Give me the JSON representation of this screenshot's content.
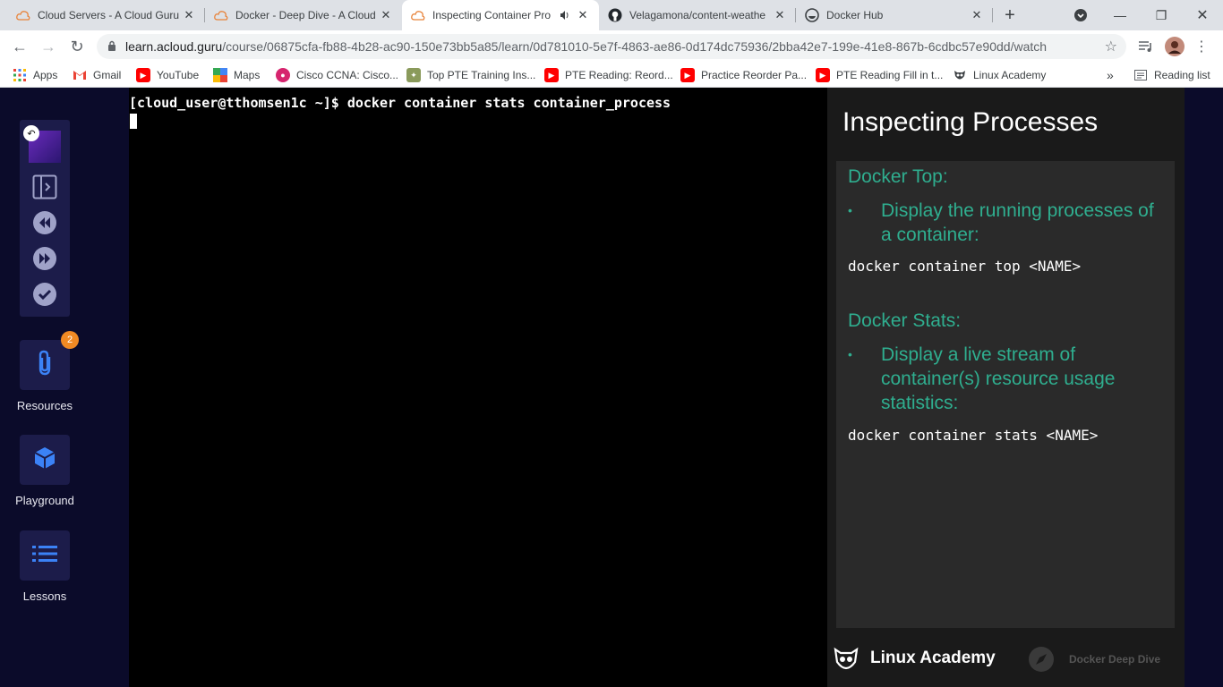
{
  "tabs": [
    {
      "title": "Cloud Servers - A Cloud Guru",
      "favicon": "cloud-icon"
    },
    {
      "title": "Docker - Deep Dive - A Cloud",
      "favicon": "cloud-icon"
    },
    {
      "title": "Inspecting Container Pro",
      "favicon": "cloud-icon",
      "active": true,
      "audio": true
    },
    {
      "title": "Velagamona/content-weathe",
      "favicon": "github-icon"
    },
    {
      "title": "Docker Hub",
      "favicon": "docker-icon"
    }
  ],
  "address": {
    "host": "learn.acloud.guru",
    "path": "/course/06875cfa-fb88-4b28-ac90-150e73bb5a85/learn/0d781010-5e7f-4863-ae86-0d174dc75936/2bba42e7-199e-41e8-867b-6cdbc57e90dd/watch"
  },
  "bookmarks": {
    "apps": "Apps",
    "gmail": "Gmail",
    "youtube": "YouTube",
    "maps": "Maps",
    "cisco": "Cisco CCNA: Cisco...",
    "pte_training": "Top PTE Training Ins...",
    "pte_reading": "PTE Reading: Reord...",
    "practice": "Practice Reorder Pa...",
    "pte_fill": "PTE Reading Fill in t...",
    "linux_academy": "Linux Academy",
    "more": "»",
    "reading_list": "Reading list"
  },
  "rail": {
    "resources": {
      "label": "Resources",
      "badge": "2"
    },
    "playground": {
      "label": "Playground"
    },
    "lessons": {
      "label": "Lessons"
    }
  },
  "terminal": {
    "prompt": "[cloud_user@tthomsen1c ~]$ docker container stats container_process"
  },
  "slide": {
    "title": "Inspecting Processes",
    "top_heading": "Docker Top:",
    "top_bullet": "Display the running processes of a container:",
    "top_code": "docker container top <NAME>",
    "stats_heading": "Docker Stats:",
    "stats_bullet": "Display a live stream of container(s) resource usage statistics:",
    "stats_code": "docker container stats <NAME>",
    "brand": "Linux Academy",
    "course": "Docker Deep Dive"
  },
  "colors": {
    "accent_green": "#2fae8f",
    "rail_bg": "#0b0b2a",
    "badge": "#f08a24"
  }
}
